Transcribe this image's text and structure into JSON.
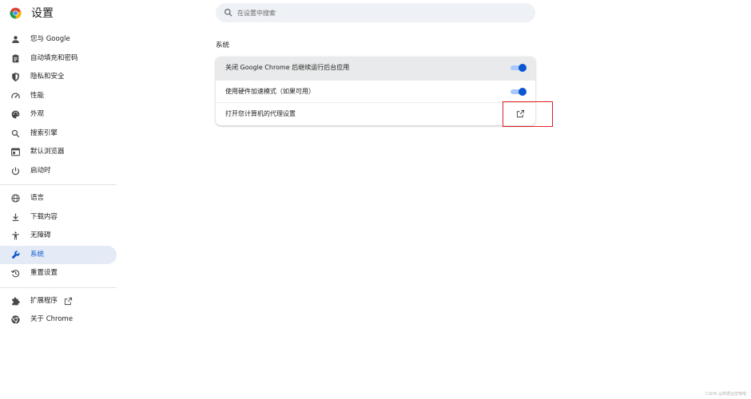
{
  "header": {
    "title": "设置",
    "search_placeholder": "在设置中搜索"
  },
  "sidebar": {
    "items": [
      {
        "label": "您与 Google",
        "icon": "person-icon"
      },
      {
        "label": "自动填充和密码",
        "icon": "clipboard-icon"
      },
      {
        "label": "隐私和安全",
        "icon": "shield-icon"
      },
      {
        "label": "性能",
        "icon": "speedometer-icon"
      },
      {
        "label": "外观",
        "icon": "palette-icon"
      },
      {
        "label": "搜索引擎",
        "icon": "search-icon"
      },
      {
        "label": "默认浏览器",
        "icon": "browser-icon"
      },
      {
        "label": "启动时",
        "icon": "power-icon"
      },
      {
        "label": "语言",
        "icon": "globe-icon"
      },
      {
        "label": "下载内容",
        "icon": "download-icon"
      },
      {
        "label": "无障碍",
        "icon": "accessibility-icon"
      },
      {
        "label": "系统",
        "icon": "wrench-icon",
        "active": true
      },
      {
        "label": "重置设置",
        "icon": "history-icon"
      },
      {
        "label": "扩展程序",
        "icon": "puzzle-icon"
      },
      {
        "label": "关于 Chrome",
        "icon": "chrome-icon"
      }
    ]
  },
  "main": {
    "section_title": "系统",
    "rows": [
      {
        "label": "关闭 Google Chrome 后继续运行后台应用",
        "control": "toggle",
        "enabled": true
      },
      {
        "label": "使用硬件加速模式（如果可用）",
        "control": "toggle",
        "enabled": true
      },
      {
        "label": "打开您计算机的代理设置",
        "control": "external-link",
        "icon": "open-in-new-icon"
      }
    ]
  },
  "colors": {
    "accent": "#0b57d0",
    "toggle_track": "#a8c7fa",
    "active_nav_bg": "#e4eaf6",
    "highlight_box": "#e02020"
  },
  "watermark": "CSDN @数据运营喵喵"
}
